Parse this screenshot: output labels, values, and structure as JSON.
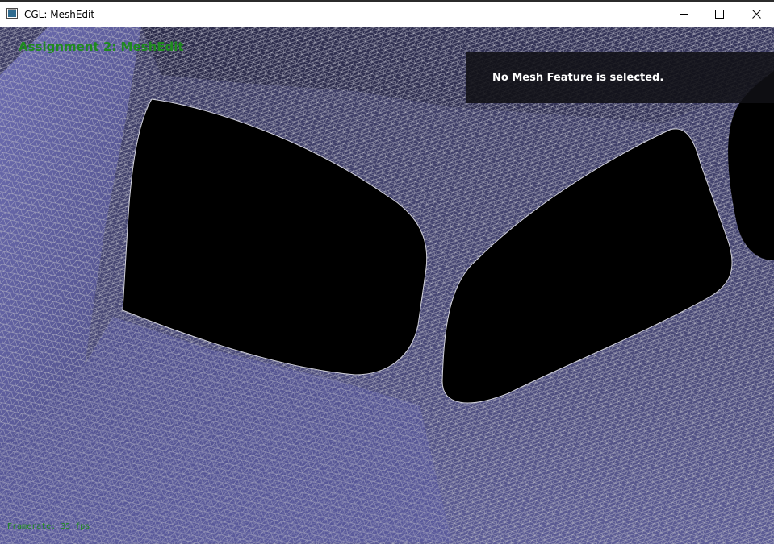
{
  "window": {
    "title": "CGL: MeshEdit",
    "app_icon": "window-app-icon",
    "controls": {
      "minimize_icon": "minimize-icon",
      "maximize_icon": "maximize-icon",
      "close_icon": "close-icon"
    }
  },
  "viewport": {
    "assignment_label": "Assignment 2: MeshEdit",
    "info_panel_text": "No Mesh Feature is selected.",
    "framerate_label": "Framerate: 35 fps"
  },
  "colors": {
    "overlay_text_green": "#1f8a1f",
    "mesh_face": "#5a5a8e",
    "mesh_wire": "#b9b9c6",
    "background": "#000000",
    "panel_bg": "#101014"
  }
}
